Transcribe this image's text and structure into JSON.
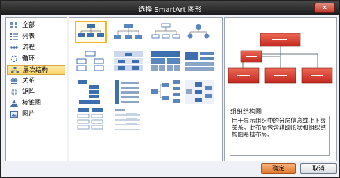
{
  "window": {
    "title": "选择 SmartArt 图形",
    "close_label": "x"
  },
  "sidebar": {
    "items": [
      {
        "label": "全部",
        "icon": "all-icon"
      },
      {
        "label": "列表",
        "icon": "list-icon"
      },
      {
        "label": "流程",
        "icon": "process-icon"
      },
      {
        "label": "循环",
        "icon": "cycle-icon"
      },
      {
        "label": "层次结构",
        "icon": "hierarchy-icon",
        "selected": true
      },
      {
        "label": "关系",
        "icon": "relationship-icon"
      },
      {
        "label": "矩阵",
        "icon": "matrix-icon"
      },
      {
        "label": "棱锥图",
        "icon": "pyramid-icon"
      },
      {
        "label": "图片",
        "icon": "picture-icon"
      }
    ]
  },
  "gallery": {
    "selected_index": 0,
    "count": 14
  },
  "preview": {
    "name": "组织结构图",
    "description": "用于显示组织中的分层信息或上下级关系。此布局包含辅助形状和组织结构图悬挂布局。"
  },
  "buttons": {
    "ok_label": "确定",
    "cancel_label": "取消"
  },
  "colors": {
    "accent": "#e07a30",
    "selection": "#ffd46b",
    "preview_shape": "#d9322b",
    "thumb_shape": "#3d6fae"
  }
}
